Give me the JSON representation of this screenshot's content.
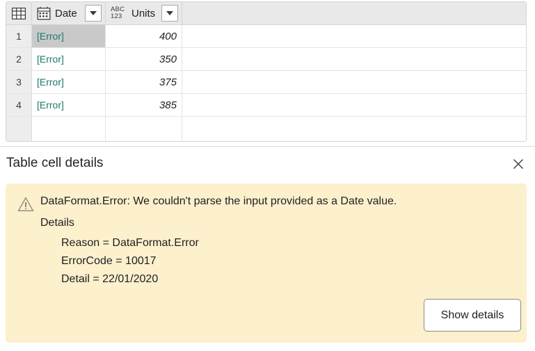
{
  "grid": {
    "corner_icon": "table-icon",
    "columns": [
      {
        "key": "date",
        "label": "Date",
        "type_icon": "calendar-icon",
        "filter_icon": "chevron-down-icon"
      },
      {
        "key": "units",
        "label": "Units",
        "type_icon": "abc123-icon",
        "abc": "ABC",
        "num": "123",
        "filter_icon": "chevron-down-icon"
      }
    ],
    "rows": [
      {
        "num": "1",
        "date": "[Error]",
        "units": "400",
        "selected": true
      },
      {
        "num": "2",
        "date": "[Error]",
        "units": "350",
        "selected": false
      },
      {
        "num": "3",
        "date": "[Error]",
        "units": "375",
        "selected": false
      },
      {
        "num": "4",
        "date": "[Error]",
        "units": "385",
        "selected": false
      }
    ],
    "error_text_color": "#1a7a6a",
    "selection_color": "#c9c9c9",
    "header_bg": "#e9e9e9"
  },
  "details": {
    "title": "Table cell details",
    "close_icon": "close-icon",
    "warning": {
      "icon": "warning-triangle-icon",
      "message": "DataFormat.Error: We couldn't parse the input provided as a Date value.",
      "details_label": "Details",
      "lines": [
        "Reason = DataFormat.Error",
        "ErrorCode = 10017",
        "Detail = 22/01/2020"
      ],
      "background": "#fcf0cd"
    },
    "show_details_label": "Show details"
  }
}
